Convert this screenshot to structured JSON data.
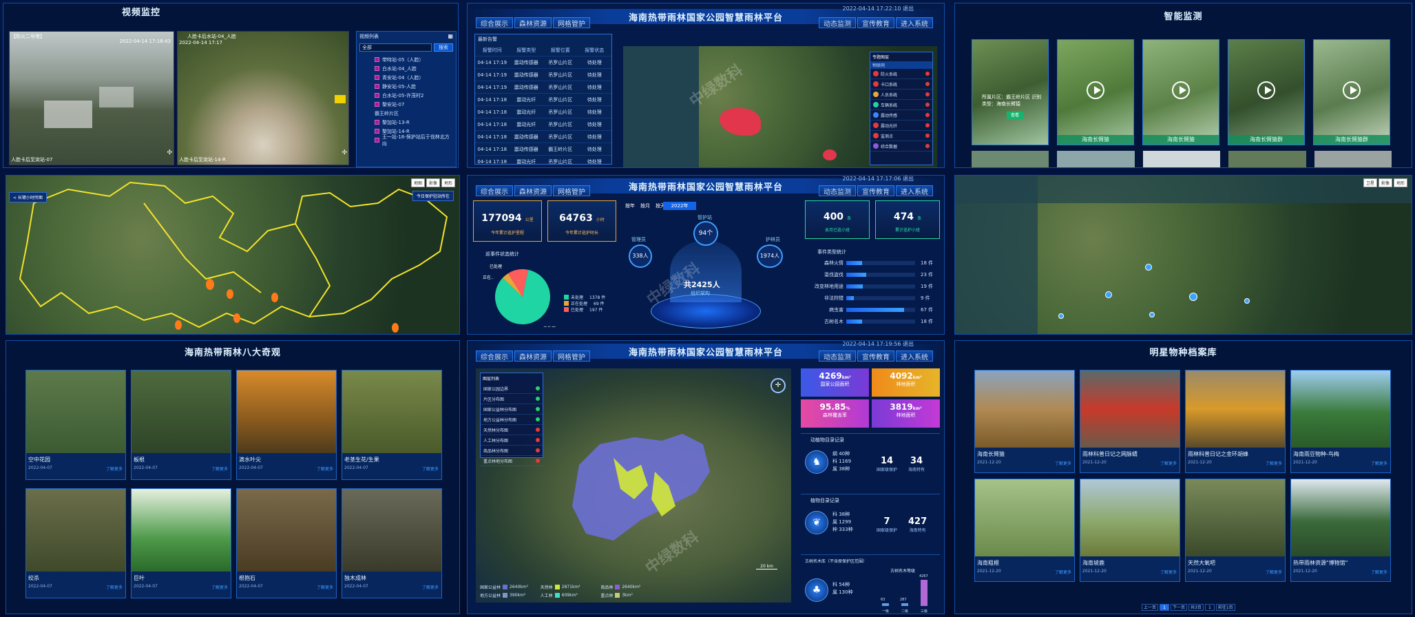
{
  "video": {
    "title": "视频监控",
    "cam1": {
      "label": "【防火二号塔】",
      "timestamp": "2022-04-14 17:18:43",
      "caption": "人脸卡后至突站-07"
    },
    "cam2": {
      "label": "人脸卡后水站-04_人脸",
      "timestamp": "2022-04-14 17:17",
      "caption": "人脸卡后至突站-14-R"
    },
    "list_title": "视频列表",
    "filter": "全部",
    "search_label": "搜索",
    "items": [
      "带特站-05（人脸）",
      "白水站-04_人脸",
      "青安站-04（人脸）",
      "静安站-05-人脸",
      "白水站-05-许茂村2",
      "黎安站-07",
      "霸王岭片区",
      "黎加站-13-R",
      "黎加站-14-R",
      "王一站-18-保护站后于伐林北方向"
    ]
  },
  "top_platform": {
    "title": "海南热带雨林国家公园智慧雨林平台",
    "datetime": "2022-04-14 17:22:10",
    "logout": "退出",
    "nav_left": [
      "综合展示",
      "森林资源",
      "网格管护"
    ],
    "nav_right": [
      "动态监测",
      "宣传教育",
      "进入系统"
    ],
    "table_title": "最新告警",
    "table_headers": [
      "报警时间",
      "报警类型",
      "报警位置",
      "报警状态"
    ],
    "rows": [
      [
        "04-14 17:19",
        "震动传感器",
        "吊罗山片区",
        "待处理"
      ],
      [
        "04-14 17:19",
        "震动传感器",
        "吊罗山片区",
        "待处理"
      ],
      [
        "04-14 17:19",
        "震动传感器",
        "吊罗山片区",
        "待处理"
      ],
      [
        "04-14 17:18",
        "震动光纤",
        "吊罗山片区",
        "待处理"
      ],
      [
        "04-14 17:18",
        "震动光纤",
        "吊罗山片区",
        "待处理"
      ],
      [
        "04-14 17:18",
        "震动光纤",
        "吊罗山片区",
        "待处理"
      ],
      [
        "04-14 17:18",
        "震动传感器",
        "吊罗山片区",
        "待处理"
      ],
      [
        "04-14 17:18",
        "震动传感器",
        "霸王岭片区",
        "待处理"
      ],
      [
        "04-14 17:18",
        "震动光纤",
        "吊罗山片区",
        "待处理"
      ]
    ],
    "map_panel_title": "专题图层",
    "map_panel_sub": "物联网",
    "map_layers": [
      "防火系统",
      "卡口系统",
      "人员系统",
      "车辆系统",
      "震动传感",
      "震动光纤",
      "监测点",
      "综合数据"
    ]
  },
  "smart_monitor": {
    "title": "智能监测",
    "first_text": "所属片区：霸王岭片区 识别类型：海南长臂猿",
    "first_btn": "查看",
    "labels": [
      "海南长臂猿",
      "海南长臂猿",
      "海南长臂猿群",
      "海南长臂猿群"
    ]
  },
  "map_left": {
    "back_label": "< 长臂小时所图",
    "right_label": "今日保护驻站所在",
    "map_types": [
      "地图",
      "影像",
      "地形"
    ]
  },
  "middle_dashboard": {
    "title": "海南热带雨林国家公园智慧雨林平台",
    "datetime": "2022-04-14 17:17:06",
    "logout": "退出",
    "stat1": {
      "value": "177094",
      "unit": "公里",
      "label": "今年累计巡护里程"
    },
    "stat2": {
      "value": "64763",
      "unit": "小时",
      "label": "今年累计巡护时长"
    },
    "period_tabs": [
      "按年",
      "按月",
      "按天"
    ],
    "year": "2022年",
    "ring_caption": "管护站",
    "ring_center": "94个",
    "left_node": {
      "label": "管理员",
      "value": "338人"
    },
    "right_node": {
      "label": "护林员",
      "value": "1974人"
    },
    "total": "共2425人",
    "org_label": "组织架构",
    "pie_title": "巡事件状态统计",
    "pie_labels": [
      "已处理",
      "正在..",
      "未处理"
    ],
    "pie_values": [
      1378,
      69,
      197
    ],
    "legend": [
      "未处理",
      "正在处理",
      "已处理"
    ],
    "legend_values": [
      "1378 件",
      "69 件",
      "197 件"
    ],
    "colors": {
      "done": "#1fd5a3",
      "doing": "#e8a63a",
      "todo": "#ff5c5c"
    },
    "stat3": {
      "value": "400",
      "unit": "条",
      "label": "本月已巡小班"
    },
    "stat4": {
      "value": "474",
      "unit": "条",
      "label": "累计巡护小班"
    },
    "event_title": "事件类型统计",
    "events": [
      {
        "name": "森林火情",
        "value": 18,
        "label": "18 件"
      },
      {
        "name": "滥伐盗伐",
        "value": 23,
        "label": "23 件"
      },
      {
        "name": "改变林地用途",
        "value": 19,
        "label": "19 件"
      },
      {
        "name": "非法狩猎",
        "value": 9,
        "label": "9 件"
      },
      {
        "name": "病虫害",
        "value": 67,
        "label": "67 件"
      },
      {
        "name": "古树名木",
        "value": 18,
        "label": "18 件"
      }
    ]
  },
  "bottom_left": {
    "title": "海南热带雨林八大奇观",
    "more": "了解更多",
    "items": [
      {
        "name": "空中花园",
        "date": "2022-04-07"
      },
      {
        "name": "板根",
        "date": "2022-04-07"
      },
      {
        "name": "滴水叶尖",
        "date": "2022-04-07"
      },
      {
        "name": "老茎生花/生果",
        "date": "2022-04-07"
      },
      {
        "name": "绞杀",
        "date": "2022-04-07"
      },
      {
        "name": "巨叶",
        "date": "2022-04-07"
      },
      {
        "name": "根抱石",
        "date": "2022-04-07"
      },
      {
        "name": "独木成林",
        "date": "2022-04-07"
      }
    ]
  },
  "bottom_center": {
    "title": "海南热带雨林国家公园智慧雨林平台",
    "datetime": "2022-04-14 17:19:56",
    "logout": "退出",
    "layer_title": "图层列表",
    "layers": [
      "国家公园边界",
      "片区分布图",
      "国家公益林分布图",
      "地方公益林分布图",
      "天然林分布图",
      "人工林分布图",
      "商品林分布图",
      "重点林地分布图"
    ],
    "areas": [
      {
        "value": "4269",
        "unit": "km²",
        "label": "国家公园面积"
      },
      {
        "value": "4092",
        "unit": "km²",
        "label": "林地面积"
      },
      {
        "value": "95.85",
        "unit": "%",
        "label": "森林覆盖率"
      },
      {
        "value": "3819",
        "unit": "km²",
        "label": "林地面积"
      }
    ],
    "animal_title": "动植物目录记录",
    "animal_lines": [
      "纲 40种",
      "科 1169",
      "属 38种"
    ],
    "animal_nat": "14",
    "animal_nat_lab": "国家级保护",
    "animal_hn": "34",
    "animal_hn_lab": "海南特有",
    "plant_title": "植物目录记录",
    "plant_lines": [
      "科 38种",
      "属 1299",
      "种 333种"
    ],
    "plant_nat": "7",
    "plant_nat_lab": "国家级保护",
    "plant_hn": "427",
    "plant_hn_lab": "海南特有",
    "tree_title": "古树名木库（不含原保护区范围）",
    "tree_lines": [
      "科 54种",
      "属 130种"
    ],
    "tree_grade_title": "古树名木等级",
    "tree_grades": [
      {
        "label": "一级",
        "value": 63
      },
      {
        "label": "二级",
        "value": 287
      },
      {
        "label": "三级",
        "value": 4267
      }
    ],
    "legend": [
      {
        "name": "国家公益林",
        "val": "2640km²",
        "color": "#6b6fd0"
      },
      {
        "name": "天然林",
        "val": "2871km²",
        "color": "#d3e83a"
      },
      {
        "name": "商品林",
        "val": "2640km²",
        "color": "#8c5cd6"
      },
      {
        "name": "地方公益林",
        "val": "390km²",
        "color": "#7d98c7"
      },
      {
        "name": "人工林",
        "val": "609km²",
        "color": "#3fe1c9"
      },
      {
        "name": "重点林",
        "val": "3km²",
        "color": "#c9c97c"
      }
    ],
    "scale": "20 km"
  },
  "bottom_right": {
    "title": "明星物种档案库",
    "more": "了解更多",
    "items": [
      {
        "name": "海南长臂猿",
        "date": "2021-12-20"
      },
      {
        "name": "雨林科普日记之网脉蜻",
        "date": "2021-12-20"
      },
      {
        "name": "雨林科普日记之金环胡蜂",
        "date": "2021-12-20"
      },
      {
        "name": "海南雨豆物种-鸟梅",
        "date": "2021-12-20"
      },
      {
        "name": "海南粗榧",
        "date": "2021-12-20"
      },
      {
        "name": "海南坡鹿",
        "date": "2021-12-20"
      },
      {
        "name": "天然大氧吧",
        "date": "2021-12-20"
      },
      {
        "name": "热带雨林资源\"博物馆\"",
        "date": "2021-12-20"
      }
    ],
    "pager": [
      "上一页",
      "1",
      "下一页",
      "共3页",
      "1",
      "前往1页"
    ]
  },
  "right_map": {
    "map_types": [
      "卫星",
      "影像",
      "地形"
    ]
  },
  "watermark": "中绿数科"
}
